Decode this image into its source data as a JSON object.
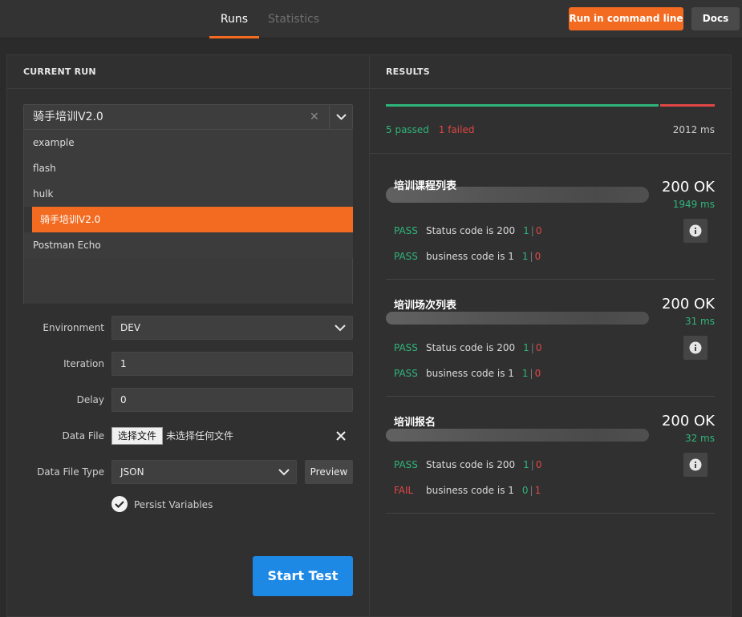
{
  "tabs": {
    "runs": "Runs",
    "statistics": "Statistics"
  },
  "toolbar": {
    "run_cli": "Run in command line",
    "docs": "Docs"
  },
  "left": {
    "header": "CURRENT RUN",
    "collection": {
      "selected": "骑手培训V2.0",
      "options": [
        "example",
        "flash",
        "hulk",
        "骑手培训V2.0",
        "Postman Echo"
      ]
    },
    "form": {
      "environment": {
        "label": "Environment",
        "value": "DEV"
      },
      "iteration": {
        "label": "Iteration",
        "value": "1"
      },
      "delay": {
        "label": "Delay",
        "value": "0"
      },
      "data_file": {
        "label": "Data File",
        "button": "选择文件",
        "status": "未选择任何文件"
      },
      "data_file_type": {
        "label": "Data File Type",
        "value": "JSON",
        "preview": "Preview"
      },
      "persist": {
        "label": "Persist Variables",
        "checked": true
      }
    },
    "start": "Start Test"
  },
  "right": {
    "header": "RESULTS",
    "summary": {
      "passed": "5 passed",
      "failed": "1 failed",
      "total_time": "2012 ms",
      "pass_fraction": 0.833
    },
    "requests": [
      {
        "name": "培训课程列表",
        "status": "200 OK",
        "time": "1949 ms",
        "tests": [
          {
            "result": "PASS",
            "name": "Status code is 200",
            "pass": "1",
            "fail": "0"
          },
          {
            "result": "PASS",
            "name": "business code is 1",
            "pass": "1",
            "fail": "0"
          }
        ]
      },
      {
        "name": "培训场次列表",
        "status": "200 OK",
        "time": "31 ms",
        "tests": [
          {
            "result": "PASS",
            "name": "Status code is 200",
            "pass": "1",
            "fail": "0"
          },
          {
            "result": "PASS",
            "name": "business code is 1",
            "pass": "1",
            "fail": "0"
          }
        ]
      },
      {
        "name": "培训报名",
        "status": "200 OK",
        "time": "32 ms",
        "tests": [
          {
            "result": "PASS",
            "name": "Status code is 200",
            "pass": "1",
            "fail": "0"
          },
          {
            "result": "FAIL",
            "name": "business code is 1",
            "pass": "0",
            "fail": "1"
          }
        ]
      }
    ]
  },
  "colors": {
    "accent": "#f26b21",
    "pass": "#2fb57a",
    "fail": "#e14646",
    "primary": "#1e88e5"
  },
  "icons": [
    "clear-icon",
    "chevron-down-icon",
    "close-icon",
    "check-icon",
    "info-icon"
  ]
}
